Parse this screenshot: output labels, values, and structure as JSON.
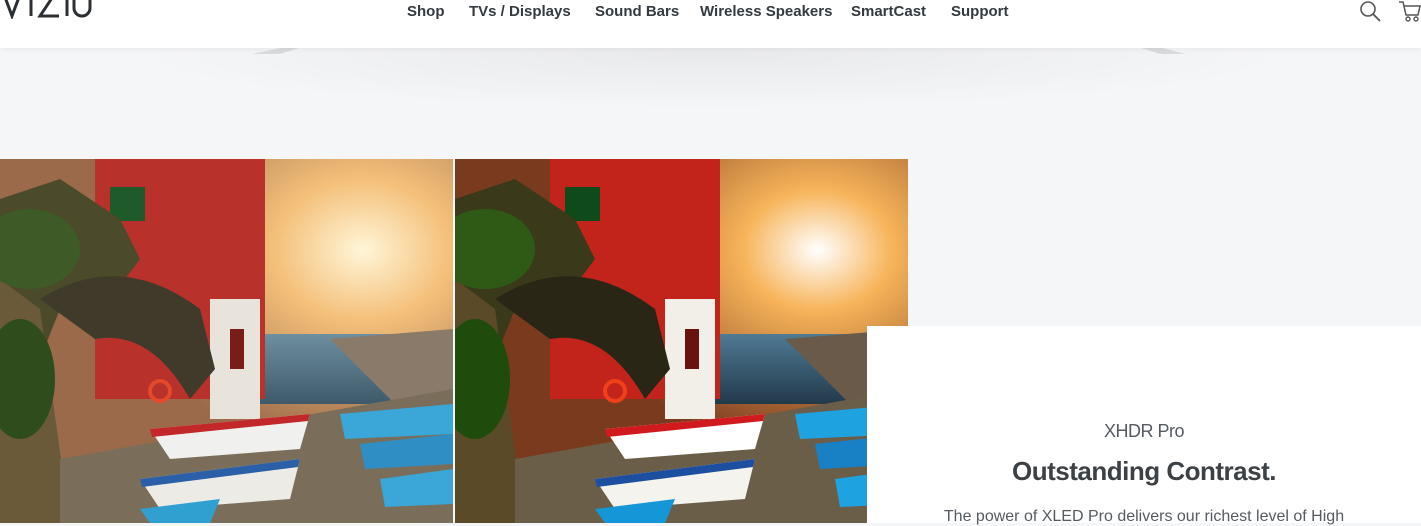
{
  "header": {
    "logo_text": "VIZIO",
    "nav": [
      {
        "label": "Shop"
      },
      {
        "label": "TVs / Displays"
      },
      {
        "label": "Sound Bars"
      },
      {
        "label": "Wireless Speakers"
      },
      {
        "label": "SmartCast"
      },
      {
        "label": "Support"
      }
    ],
    "icons": [
      "search-icon",
      "cart-icon"
    ]
  },
  "comparison": {
    "images": [
      "harbor-boats-sunset-left",
      "harbor-boats-sunset-right"
    ]
  },
  "feature_card": {
    "eyebrow": "XHDR Pro",
    "headline": "Outstanding Contrast.",
    "body": "The power of XLED Pro delivers our richest level of High"
  },
  "colors": {
    "nav_text": "#333a40",
    "page_bg": "#f5f6f8",
    "card_bg": "#ffffff",
    "headline": "#3c4146"
  }
}
